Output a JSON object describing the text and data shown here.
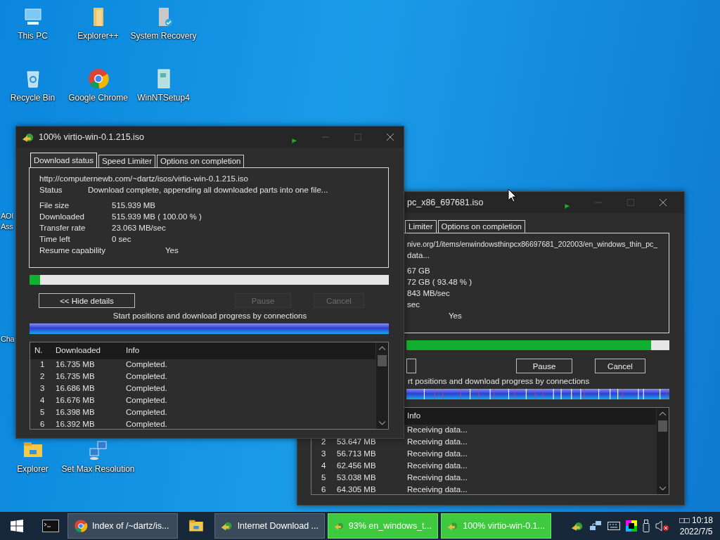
{
  "desktop_icons": [
    {
      "label": "This PC",
      "kind": "pc"
    },
    {
      "label": "Explorer++",
      "kind": "folder"
    },
    {
      "label": "System Recovery",
      "kind": "recovery"
    },
    {
      "label": "Recycle Bin",
      "kind": "recycle"
    },
    {
      "label": "Google Chrome",
      "kind": "chrome"
    },
    {
      "label": "WinNTSetup4",
      "kind": "setup"
    },
    {
      "label": "Explorer",
      "kind": "explorer"
    },
    {
      "label": "Set Max Resolution",
      "kind": "network"
    }
  ],
  "cut_icon_labels": [
    {
      "lines": [
        "AOI",
        "Ass"
      ]
    },
    {
      "lines": [
        "Cha"
      ]
    }
  ],
  "windows": [
    {
      "title": "100% virtio-win-0.1.215.iso",
      "tabs": [
        {
          "label": "Download status",
          "selected": true
        },
        {
          "label": "Speed Limiter",
          "selected": false
        },
        {
          "label": "Options on completion",
          "selected": false
        }
      ],
      "url": "http://computernewb.com/~dartz/isos/virtio-win-0.1.215.iso",
      "status_label": "Status",
      "status": "Download complete, appending all downloaded parts into one file...",
      "fields": [
        {
          "label": "File size",
          "value": "515.939  MB"
        },
        {
          "label": "Downloaded",
          "value": "515.939  MB  ( 100.00 % )"
        },
        {
          "label": "Transfer rate",
          "value": "23.063  MB/sec"
        },
        {
          "label": "Time left",
          "value": "0 sec"
        }
      ],
      "resume": {
        "label": "Resume capability",
        "value": "Yes"
      },
      "progress": {
        "level": 0.03
      },
      "buttons": [
        {
          "label": "<< Hide details",
          "disabled": false
        },
        {
          "label": "Pause",
          "disabled": true
        },
        {
          "label": "Cancel",
          "disabled": true
        }
      ],
      "caption": "Start positions and download progress by connections",
      "connections": {
        "kind": "plain"
      },
      "table": {
        "columns": [
          {
            "label": "N.",
            "kind": "n"
          },
          {
            "label": "Downloaded",
            "kind": "downloaded"
          },
          {
            "label": "Info",
            "kind": "info"
          }
        ],
        "rows": [
          {
            "n": "1",
            "downloaded": "16.735  MB",
            "info": "Completed."
          },
          {
            "n": "2",
            "downloaded": "16.735  MB",
            "info": "Completed."
          },
          {
            "n": "3",
            "downloaded": "16.686  MB",
            "info": "Completed."
          },
          {
            "n": "4",
            "downloaded": "16.676  MB",
            "info": "Completed."
          },
          {
            "n": "5",
            "downloaded": "16.398  MB",
            "info": "Completed."
          },
          {
            "n": "6",
            "downloaded": "16.392  MB",
            "info": "Completed."
          }
        ]
      }
    },
    {
      "title": "pc_x86_697681.iso",
      "tabs": [
        {
          "label": "Limiter",
          "selected": false
        },
        {
          "label": "Options on completion",
          "selected": false
        }
      ],
      "url": "nive.org/1/items/enwindowsthinpcx86697681_202003/en_windows_thin_pc_",
      "status": "data...",
      "fields": [
        {
          "value": "67  GB"
        },
        {
          "value": "72  GB  ( 93.48 % )"
        },
        {
          "value": "843  MB/sec"
        },
        {
          "value": "sec"
        }
      ],
      "resume": {
        "value": "Yes"
      },
      "progress": {
        "level": 0.93
      },
      "buttons": [
        {
          "disabled": false
        },
        {
          "label": "Pause",
          "disabled": false
        },
        {
          "label": "Cancel",
          "disabled": false
        }
      ],
      "caption": "rt positions and download progress by connections",
      "connections": {
        "kind": "marked"
      },
      "table": {
        "columns": [
          {
            "label": "Info",
            "kind": "info"
          }
        ],
        "rows": [
          {
            "info": "Receiving data..."
          },
          {
            "n": "2",
            "downloaded": "53.647  MB",
            "info": "Receiving data..."
          },
          {
            "n": "3",
            "downloaded": "56.713  MB",
            "info": "Receiving data..."
          },
          {
            "n": "4",
            "downloaded": "62.456  MB",
            "info": "Receiving data..."
          },
          {
            "n": "5",
            "downloaded": "53.038  MB",
            "info": "Receiving data..."
          },
          {
            "n": "6",
            "downloaded": "64.305  MB",
            "info": "Receiving data..."
          }
        ]
      }
    }
  ],
  "taskbar": {
    "items": [
      {
        "kind": "chrome",
        "label": "Index of /~dartz/is...",
        "highlighted": false
      },
      {
        "kind": "explorer",
        "highlighted": false
      },
      {
        "kind": "idm",
        "label": "Internet Download ...",
        "highlighted": false
      },
      {
        "kind": "idm",
        "label": "93% en_windows_t...",
        "highlighted": true
      },
      {
        "kind": "idm",
        "label": "100% virtio-win-0.1...",
        "highlighted": true
      }
    ],
    "clock_prefix": "□□",
    "time": "10:18",
    "date": "2022/7/5"
  }
}
